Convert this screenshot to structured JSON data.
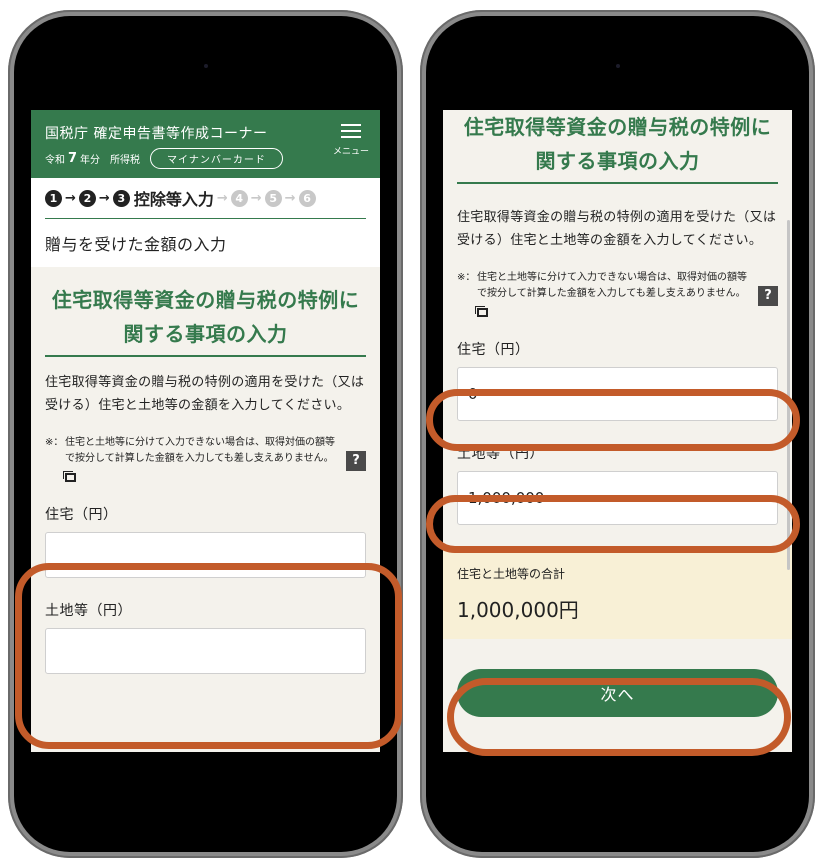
{
  "header": {
    "title": "国税庁 確定申告書等作成コーナー",
    "era": "令和",
    "year": "7",
    "year_suffix": "年分",
    "tax_type": "所得税",
    "mynumber_label": "マイナンバーカード",
    "menu_label": "メニュー"
  },
  "steps": {
    "items": [
      "1",
      "2",
      "3",
      "4",
      "5",
      "6"
    ],
    "current_label": "控除等入力"
  },
  "page": {
    "subtitle": "贈与を受けた金額の入力",
    "heading_line1": "住宅取得等資金の贈与税の特例に",
    "heading_line2": "関する事項の入力",
    "description": "住宅取得等資金の贈与税の特例の適用を受けた（又は受ける）住宅と土地等の金額を入力してください。",
    "note_mark": "※：",
    "note": "住宅と土地等に分けて入力できない場合は、取得対価の額等で按分して計算した金額を入力しても差し支えありません。",
    "help_label": "?"
  },
  "form_left": {
    "house_label": "住宅（円）",
    "house_value": "",
    "land_label": "土地等（円）",
    "land_value": ""
  },
  "form_right": {
    "house_label": "住宅（円）",
    "house_value": "0",
    "land_label": "土地等（円）",
    "land_value": "1,000,000",
    "total_label": "住宅と土地等の合計",
    "total_value": "1,000,000円",
    "next_label": "次へ"
  },
  "colors": {
    "brand_green": "#357a4d",
    "highlight_orange": "#c35b2a",
    "total_background": "#f8f0d6"
  }
}
